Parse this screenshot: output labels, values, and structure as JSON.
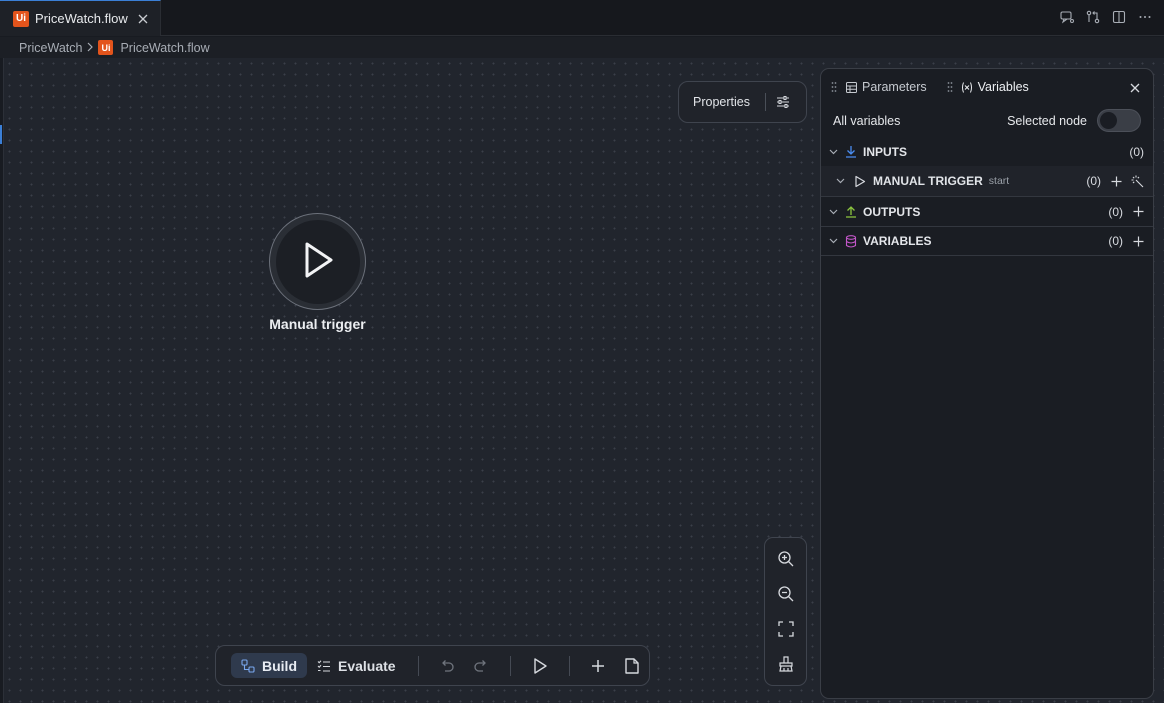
{
  "editor_tab": {
    "icon": "uipath-logo-icon",
    "logo_text": "Ui",
    "label": "PriceWatch.flow"
  },
  "window_actions": [
    "chat-icon",
    "compare-icon",
    "split-editor-icon",
    "more-icon"
  ],
  "breadcrumb": {
    "project": "PriceWatch",
    "separator": ">",
    "logo_text": "Ui",
    "file": "PriceWatch.flow"
  },
  "properties_button": {
    "label": "Properties",
    "icon": "sliders-icon"
  },
  "node": {
    "label": "Manual trigger",
    "icon": "play-icon"
  },
  "zoom_controls": [
    "zoom-in-icon",
    "zoom-out-icon",
    "fit-view-icon",
    "clean-up-icon"
  ],
  "bottom_toolbar": {
    "build_label": "Build",
    "evaluate_label": "Evaluate",
    "active_mode": "Build"
  },
  "panel": {
    "tabs": [
      {
        "label": "Parameters",
        "icon": "table-icon",
        "active": false
      },
      {
        "label": "Variables",
        "icon": "variable-icon",
        "active": true
      }
    ],
    "filter_all": "All variables",
    "filter_selected": "Selected node",
    "selected_node_toggle": false,
    "sections": {
      "inputs": {
        "label": "INPUTS",
        "count": "(0)",
        "color": "#4a8cf0"
      },
      "manual_trigger": {
        "label": "MANUAL TRIGGER",
        "tag": "start",
        "count": "(0)"
      },
      "outputs": {
        "label": "OUTPUTS",
        "count": "(0)",
        "color": "#8cc63f"
      },
      "variables": {
        "label": "VARIABLES",
        "count": "(0)",
        "color": "#c357c9"
      }
    }
  }
}
